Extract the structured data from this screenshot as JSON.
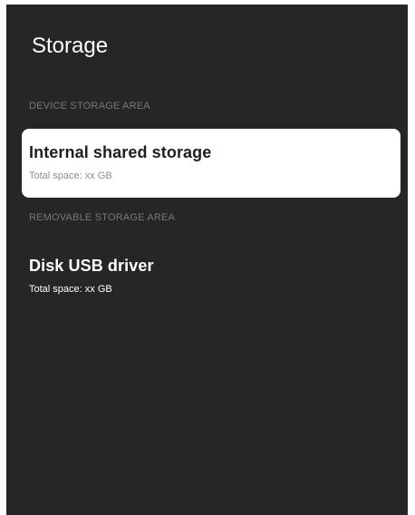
{
  "page": {
    "title": "Storage"
  },
  "sections": {
    "device": {
      "header": "DEVICE STORAGE AREA",
      "item": {
        "title": "Internal shared storage",
        "subtitle": "Total space: xx GB",
        "selected": true
      }
    },
    "removable": {
      "header": "REMOVABLE STORAGE AREA",
      "item": {
        "title": "Disk USB driver",
        "subtitle": "Total space: xx GB",
        "selected": false
      }
    }
  },
  "colors": {
    "background": "#282624",
    "selected_background": "#ffffff",
    "header_text": "#7a7876"
  }
}
